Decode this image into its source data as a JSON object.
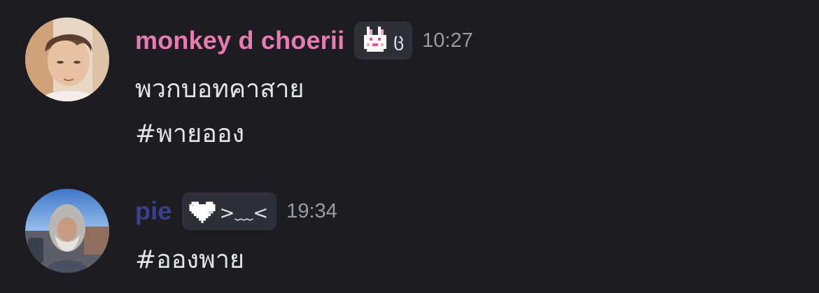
{
  "messages": [
    {
      "username": "monkey d choerii",
      "username_color": "#e87cb1",
      "tag_icon": "pixel-bunny-icon",
      "tag_text": "ც",
      "timestamp": "10:27",
      "lines": [
        "พวกบอทคาสาย",
        "#พายออง"
      ]
    },
    {
      "username": "pie",
      "username_color": "#3c3f8f",
      "tag_icon": "pixel-heart-icon",
      "tag_text": ">﹏<",
      "timestamp": "19:34",
      "lines": [
        "#อองพาย"
      ]
    }
  ],
  "colors": {
    "background": "#1c1c21",
    "tag_background": "#2f3037",
    "timestamp": "#9a9ba3",
    "message_text": "#e3e4e8"
  }
}
